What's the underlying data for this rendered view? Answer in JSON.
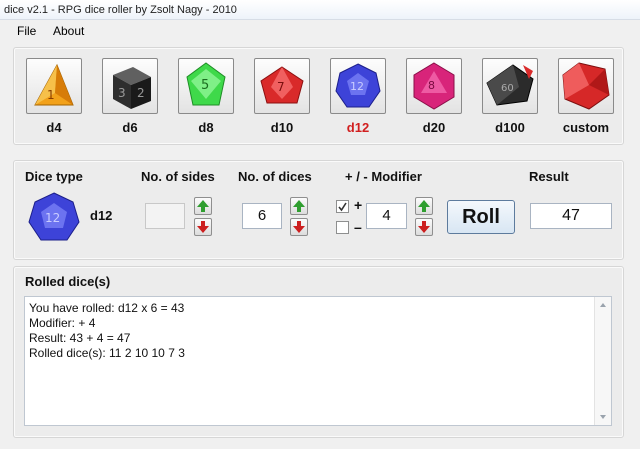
{
  "window": {
    "title": "dice v2.1 - RPG dice roller by Zsolt Nagy - 2010"
  },
  "menu": [
    {
      "label": "File"
    },
    {
      "label": "About"
    }
  ],
  "dice": [
    {
      "label": "d4",
      "color": "#f2a11a"
    },
    {
      "label": "d6",
      "color": "#3a3a3a"
    },
    {
      "label": "d8",
      "color": "#3fd94a"
    },
    {
      "label": "d10",
      "color": "#d92a2a"
    },
    {
      "label": "d12",
      "color": "#3d43d8",
      "active": true
    },
    {
      "label": "d20",
      "color": "#d8247a"
    },
    {
      "label": "d100",
      "color": "#2b2b2b"
    },
    {
      "label": "custom",
      "color": "#d62828"
    }
  ],
  "controls": {
    "dice_type_label": "Dice type",
    "selected_dice": "d12",
    "sides_label": "No. of sides",
    "sides_value": "",
    "count_label": "No. of dices",
    "count_value": "6",
    "modifier_label": "+ / - Modifier",
    "plus_sign": "+",
    "minus_sign": "–",
    "plus_checked": true,
    "minus_checked": false,
    "modifier_value": "4",
    "roll_label": "Roll",
    "result_label": "Result",
    "result_value": "47"
  },
  "rolled": {
    "title": "Rolled dice(s)",
    "lines": [
      "You have rolled: d12 x 6 = 43",
      "Modifier: + 4",
      "Result: 43 + 4 = 47",
      "Rolled dice(s):  11 2 10 10 7 3"
    ]
  },
  "icons": {
    "up_arrow": "up-arrow-icon",
    "down_arrow": "down-arrow-icon",
    "up_color": "#2f9e2f",
    "down_color": "#cc1f1f"
  }
}
